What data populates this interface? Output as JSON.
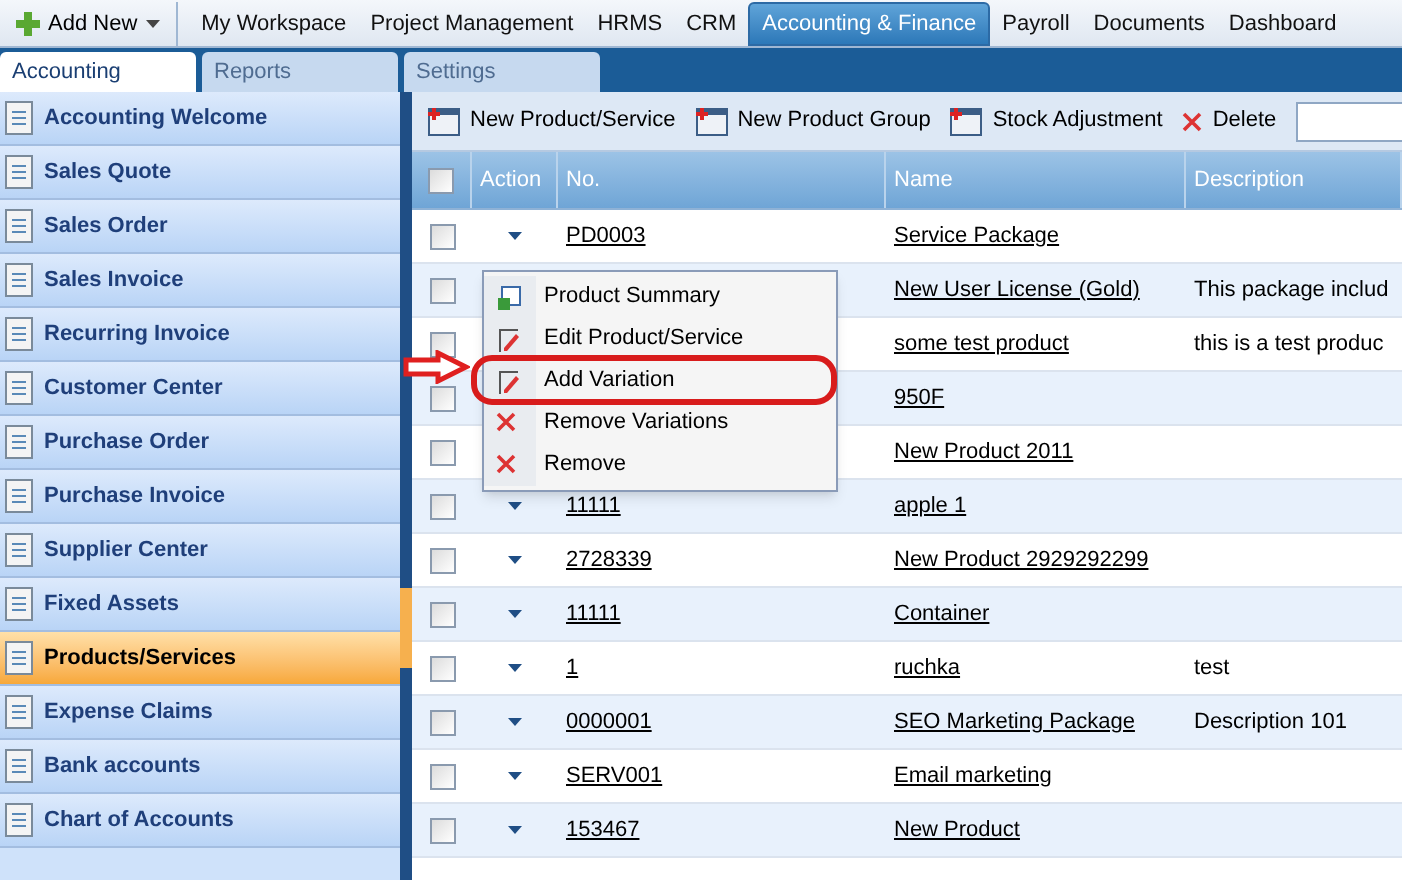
{
  "top_nav": {
    "add_new": "Add New",
    "tabs": [
      {
        "label": "My Workspace",
        "selected": false
      },
      {
        "label": "Project Management",
        "selected": false
      },
      {
        "label": "HRMS",
        "selected": false
      },
      {
        "label": "CRM",
        "selected": false
      },
      {
        "label": "Accounting & Finance",
        "selected": true
      },
      {
        "label": "Payroll",
        "selected": false
      },
      {
        "label": "Documents",
        "selected": false
      },
      {
        "label": "Dashboard",
        "selected": false
      }
    ]
  },
  "sub_tabs": [
    {
      "label": "Accounting",
      "selected": true
    },
    {
      "label": "Reports",
      "selected": false
    },
    {
      "label": "Settings",
      "selected": false
    }
  ],
  "sidebar": {
    "items": [
      {
        "label": "Accounting Welcome",
        "selected": false
      },
      {
        "label": "Sales Quote",
        "selected": false
      },
      {
        "label": "Sales Order",
        "selected": false
      },
      {
        "label": "Sales Invoice",
        "selected": false
      },
      {
        "label": "Recurring Invoice",
        "selected": false
      },
      {
        "label": "Customer Center",
        "selected": false
      },
      {
        "label": "Purchase Order",
        "selected": false
      },
      {
        "label": "Purchase Invoice",
        "selected": false
      },
      {
        "label": "Supplier Center",
        "selected": false
      },
      {
        "label": "Fixed Assets",
        "selected": false
      },
      {
        "label": "Products/Services",
        "selected": true
      },
      {
        "label": "Expense Claims",
        "selected": false
      },
      {
        "label": "Bank accounts",
        "selected": false
      },
      {
        "label": "Chart of Accounts",
        "selected": false
      }
    ]
  },
  "toolbar": [
    {
      "label": "New Product/Service",
      "kind": "new"
    },
    {
      "label": "New Product Group",
      "kind": "new"
    },
    {
      "label": "Stock Adjustment",
      "kind": "new"
    },
    {
      "label": "Delete",
      "kind": "delete"
    }
  ],
  "table": {
    "select_all_checked": false,
    "columns": [
      "Action",
      "No.",
      "Name",
      "Description"
    ],
    "rows": [
      {
        "checked": false,
        "no": "PD0003",
        "name": "Service Package"
      },
      {
        "checked": false,
        "name": "New User License (Gold)",
        "description": "This package includ"
      },
      {
        "checked": false,
        "name": "some test product",
        "description": "this is a test produc"
      },
      {
        "checked": false,
        "name": "950F"
      },
      {
        "checked": false,
        "name": "New Product 2011"
      },
      {
        "checked": false,
        "no": "11111",
        "name": "apple 1"
      },
      {
        "checked": false,
        "no": "2728339",
        "name": "New Product 2929292299"
      },
      {
        "checked": false,
        "no": "11111",
        "name": "Container"
      },
      {
        "checked": false,
        "no": "1",
        "name": "ruchka",
        "description": "test"
      },
      {
        "checked": false,
        "no": "0000001",
        "name": "SEO Marketing Package",
        "description": "Description 101"
      },
      {
        "checked": false,
        "no": "SERV001",
        "name": "Email marketing"
      },
      {
        "checked": false,
        "no": "153467",
        "name": "New Product"
      }
    ]
  },
  "context_menu": [
    {
      "label": "Product Summary",
      "kind": "summary"
    },
    {
      "label": "Edit Product/Service",
      "kind": "edit"
    },
    {
      "label": "Add Variation",
      "kind": "edit"
    },
    {
      "label": "Remove Variations",
      "kind": "remove"
    },
    {
      "label": "Remove",
      "kind": "remove"
    }
  ]
}
